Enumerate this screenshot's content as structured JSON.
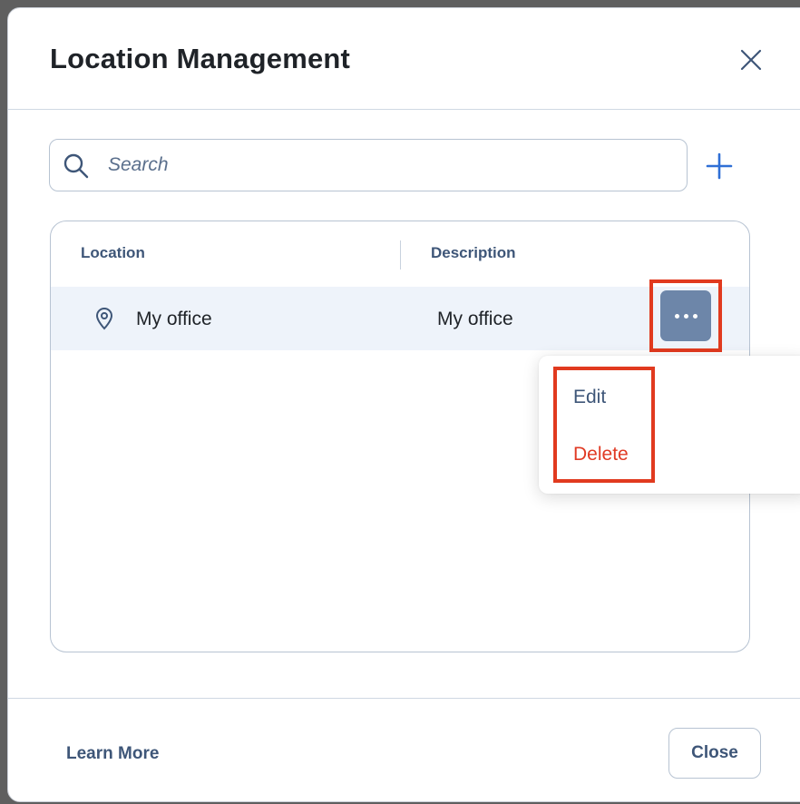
{
  "dialog": {
    "title": "Location Management",
    "close_icon": "close-icon"
  },
  "search": {
    "placeholder": "Search",
    "value": "",
    "icon": "search-icon"
  },
  "toolbar": {
    "add_icon": "plus-icon"
  },
  "table": {
    "columns": [
      "Location",
      "Description"
    ],
    "rows": [
      {
        "location": "My office",
        "description": "My office",
        "icon": "location-pin-icon",
        "actions_icon": "more-horizontal-icon"
      }
    ]
  },
  "context_menu": {
    "items": [
      {
        "label": "Edit",
        "color": "#3e5678"
      },
      {
        "label": "Delete",
        "color": "#e03a24"
      }
    ]
  },
  "footer": {
    "learn_more_label": "Learn More",
    "close_label": "Close"
  },
  "colors": {
    "accent": "#3e5678",
    "highlight": "#e13a1f",
    "row_bg": "#eef3fa",
    "action_button": "#6d86a9"
  }
}
